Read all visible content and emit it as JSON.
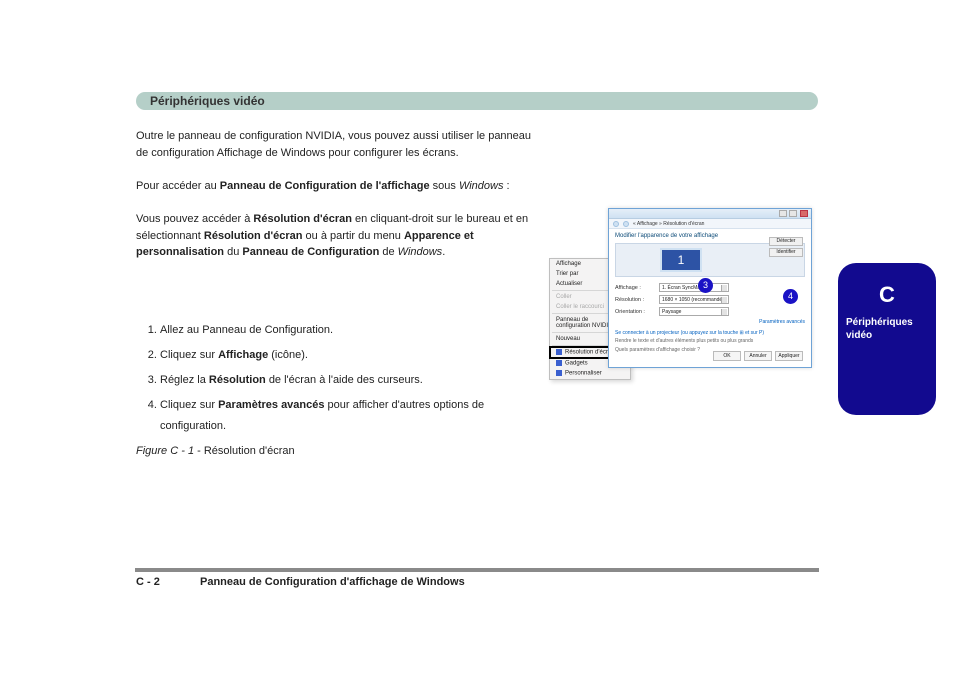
{
  "banner": {
    "title": "Périphériques vidéo"
  },
  "paragraphs": {
    "p1": "Outre le panneau de configuration NVIDIA, vous pouvez aussi utiliser le panneau de configuration Affichage de Windows pour configurer les écrans.",
    "p2_prefix": "Pour accéder au ",
    "p2_bold": "Panneau de Configuration de l'affichage",
    "p2_mid": " sous ",
    "p2_win": "Windows",
    "p2_suffix": " :",
    "p3_prefix": "Vous pouvez accéder à ",
    "p3_bold1": "Résolution d'écran",
    "p3_mid1": " en cliquant-droit sur le bureau et en sélectionnant ",
    "p3_bold2": "Résolution d'écran",
    "p3_mid2": " ou à partir du menu ",
    "p3_bold3": "Apparence et personnalisation",
    "p3_mid3": " du ",
    "p3_bold4": "Panneau de Configuration",
    "p3_mid4": " de ",
    "p3_win": "Windows",
    "p3_suffix": "."
  },
  "list": {
    "i1": "Allez au Panneau de Configuration.",
    "i2_pre": "Cliquez sur ",
    "i2_b": "Affichage",
    "i2_post": " (icône).",
    "i3_pre": "Réglez la ",
    "i3_b": "Résolution ",
    "i3_post": "de l'écran à l'aide des curseurs.",
    "i4_pre": "Cliquez sur ",
    "i4_b": "Paramètres avancés ",
    "i4_post": "pour afficher d'autres options de configuration."
  },
  "fig_caption": {
    "label": "Figure C - 1",
    "text": " - Résolution d'écran"
  },
  "context_menu": {
    "items": [
      {
        "label": "Affichage",
        "arrow": true
      },
      {
        "label": "Trier par",
        "arrow": true
      },
      {
        "label": "Actualiser"
      },
      {
        "sep": true
      },
      {
        "label": "Coller",
        "disabled": true
      },
      {
        "label": "Coller le raccourci",
        "disabled": true
      },
      {
        "sep": true
      },
      {
        "label": "Panneau de configuration NVIDIA"
      },
      {
        "sep": true
      },
      {
        "label": "Nouveau",
        "arrow": true
      },
      {
        "sep": true
      },
      {
        "label": "Résolution d'écran",
        "icon": true,
        "highlight": true
      },
      {
        "label": "Gadgets",
        "icon": true
      },
      {
        "label": "Personnaliser",
        "icon": true
      }
    ]
  },
  "window": {
    "breadcrumb": "« Affichage » Résolution d'écran",
    "heading": "Modifier l'apparence de votre affichage",
    "side_btns": [
      "Détecter",
      "Identifier"
    ],
    "monitor_num": "1",
    "rows": {
      "display_lbl": "Affichage :",
      "display_val": "1. Écran SyncMaster ▾",
      "res_lbl": "Résolution :",
      "res_val": "1680 × 1050 (recommandé)",
      "orient_lbl": "Orientation :",
      "orient_val": "Paysage"
    },
    "link1": "Se connecter à un projecteur (ou appuyez sur la touche ⊞ et sur P)",
    "hint1": "Rendre le texte et d'autres éléments plus petits ou plus grands",
    "hint2": "Quels paramètres d'affichage choisir ?",
    "adv_link": "Paramètres avancés",
    "buttons": [
      "OK",
      "Annuler",
      "Appliquer"
    ]
  },
  "dots": {
    "d3": "3",
    "d4": "4"
  },
  "sidetab": {
    "line1": "C",
    "line2": "Périphériques vidéo"
  },
  "footer": {
    "left": "C - 2",
    "right": "Panneau de Configuration d'affichage de Windows"
  }
}
